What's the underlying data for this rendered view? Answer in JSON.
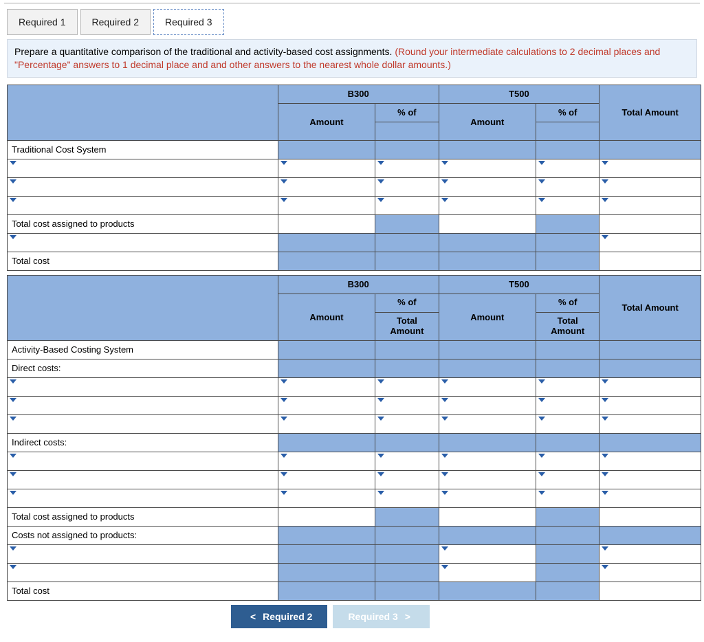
{
  "tabs": [
    "Required 1",
    "Required 2",
    "Required 3"
  ],
  "active_tab_index": 2,
  "instructions": {
    "black": "Prepare a quantitative comparison of the traditional and activity-based cost assignments. ",
    "red": "(Round your intermediate calculations to 2 decimal places and \"Percentage\" answers to 1 decimal place and and other answers to the nearest whole dollar amounts.)"
  },
  "headers": {
    "prod1": "B300",
    "prod2": "T500",
    "pct_of": "% of",
    "amount": "Amount",
    "total_amount": "Total Amount",
    "total_amount_2line": "Total\nAmount"
  },
  "rows_trad": {
    "section": "Traditional Cost System",
    "total_assigned": "Total cost assigned to products",
    "total_cost": "Total cost"
  },
  "rows_abc": {
    "section": "Activity-Based Costing System",
    "direct": "Direct costs:",
    "indirect": "Indirect costs:",
    "total_assigned": "Total cost assigned to products",
    "not_assigned": "Costs not assigned to products:",
    "total_cost": "Total cost"
  },
  "nav": {
    "prev": "Required 2",
    "next": "Required 3"
  }
}
